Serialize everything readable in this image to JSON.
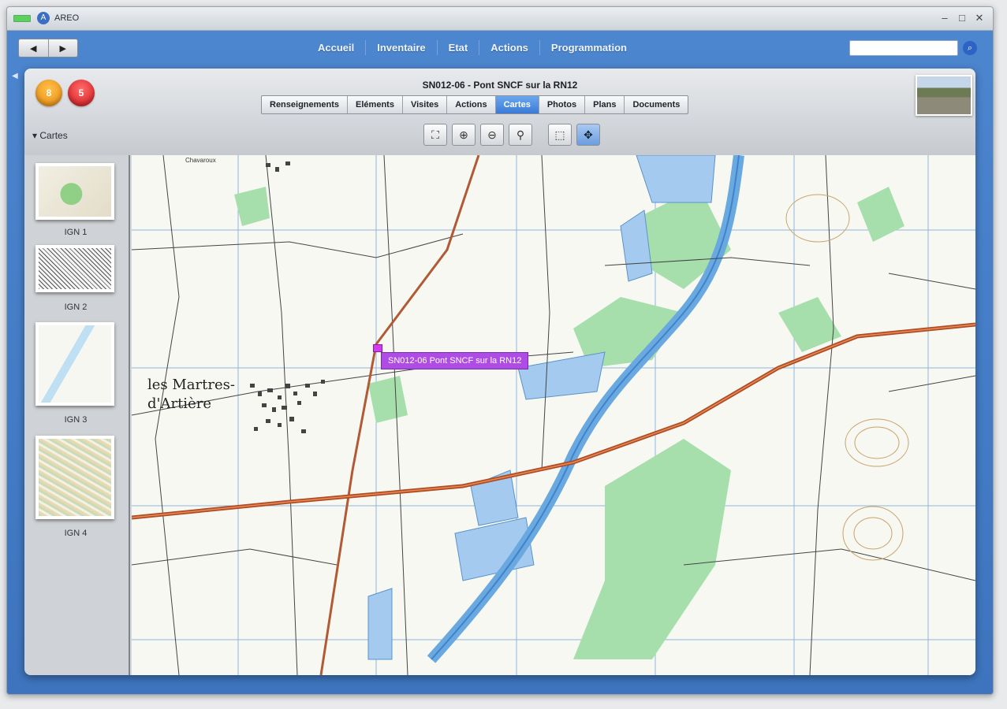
{
  "window": {
    "app_title": "AREO",
    "controls": [
      "–",
      "□",
      "✕"
    ]
  },
  "nav": {
    "back": "◀",
    "forward": "▶",
    "menu": [
      "Accueil",
      "Inventaire",
      "Etat",
      "Actions",
      "Programmation"
    ],
    "search_placeholder": ""
  },
  "header": {
    "badge_orange": "8",
    "badge_red": "5",
    "title": "SN012-06 - Pont SNCF sur la RN12",
    "tabs": [
      "Renseignements",
      "Eléments",
      "Visites",
      "Actions",
      "Cartes",
      "Photos",
      "Plans",
      "Documents"
    ],
    "active_tab": "Cartes",
    "section_label": "▾ Cartes"
  },
  "sidebar": {
    "maps": [
      {
        "label": "IGN 1"
      },
      {
        "label": "IGN 2"
      },
      {
        "label": "IGN 3"
      },
      {
        "label": "IGN 4"
      }
    ]
  },
  "map": {
    "marker_label": "SN012-06 Pont SNCF sur la RN12",
    "town_name_line1": "les Martres-",
    "town_name_line2": "d'Artière",
    "place_name": "Chavaroux"
  },
  "colors": {
    "accent": "#3d74bd",
    "active_tab": "#3b7ad6",
    "marker": "#b04ce6",
    "water": "#9bc8f0",
    "vegetation": "#9fdca8",
    "road": "#c15a2e"
  }
}
